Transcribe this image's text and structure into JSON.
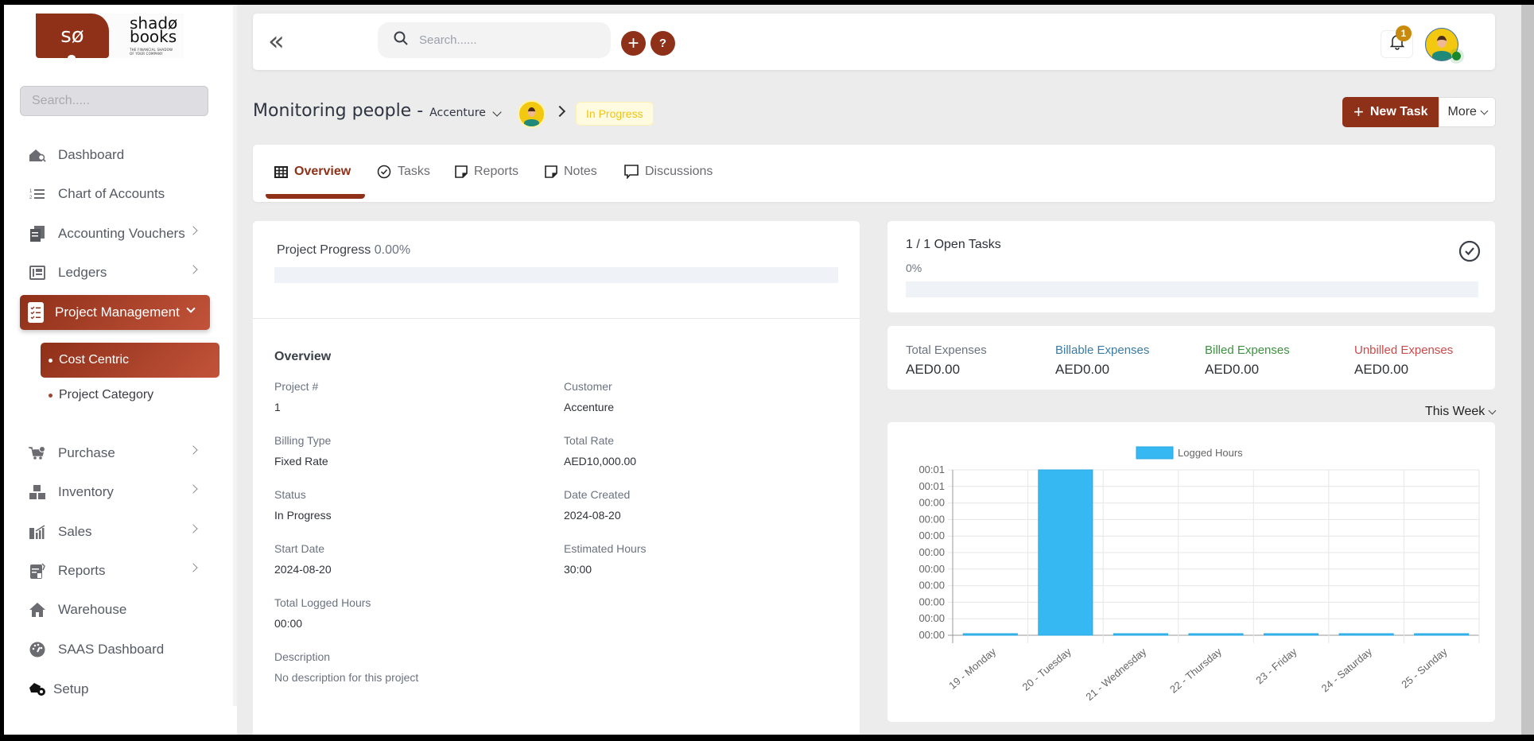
{
  "brand": {
    "logo_mark": "sø",
    "name_line1": "shadø",
    "name_line2": "books",
    "tagline_line1": "THE FINANCIAL SHADOW",
    "tagline_line2": "OF YOUR COMPANY",
    "accent_color": "#8f3019"
  },
  "sidebar": {
    "search_placeholder": "Search.....",
    "items": [
      {
        "label": "Dashboard",
        "icon": "dashboard-house-icon",
        "has_children": false
      },
      {
        "label": "Chart of Accounts",
        "icon": "numbered-list-icon",
        "has_children": false
      },
      {
        "label": "Accounting Vouchers",
        "icon": "vouchers-icon",
        "has_children": true
      },
      {
        "label": "Ledgers",
        "icon": "ledger-icon",
        "has_children": true
      },
      {
        "label": "Project Management",
        "icon": "checklist-icon",
        "has_children": true,
        "active": true,
        "expanded": true
      },
      {
        "label": "Purchase",
        "icon": "cart-icon",
        "has_children": true
      },
      {
        "label": "Inventory",
        "icon": "boxes-icon",
        "has_children": true
      },
      {
        "label": "Sales",
        "icon": "sales-chart-icon",
        "has_children": true
      },
      {
        "label": "Reports",
        "icon": "report-icon",
        "has_children": true
      },
      {
        "label": "Warehouse",
        "icon": "home-icon",
        "has_children": false
      },
      {
        "label": "SAAS Dashboard",
        "icon": "speedometer-icon",
        "has_children": false
      },
      {
        "label": "Setup",
        "icon": "setup-gear-icon",
        "has_children": false
      }
    ],
    "sub_items": [
      {
        "label": "Cost Centric",
        "active": true
      },
      {
        "label": "Project Category",
        "active": false
      }
    ]
  },
  "header": {
    "collapse_icon": "«",
    "search_placeholder": "Search......",
    "add_label": "+",
    "help_label": "?",
    "notification_count": "1"
  },
  "project": {
    "title": "Monitoring people",
    "separator": "-",
    "customer": "Accenture",
    "status": "In Progress",
    "new_task_label": "New Task",
    "new_task_icon": "+",
    "more_label": "More"
  },
  "tabs": [
    {
      "label": "Overview",
      "icon": "grid-icon",
      "active": true
    },
    {
      "label": "Tasks",
      "icon": "check-circle-icon",
      "active": false
    },
    {
      "label": "Reports",
      "icon": "note-icon",
      "active": false
    },
    {
      "label": "Notes",
      "icon": "note-icon",
      "active": false
    },
    {
      "label": "Discussions",
      "icon": "chat-icon",
      "active": false
    }
  ],
  "progress": {
    "label": "Project Progress",
    "value_text": "0.00%",
    "value": 0
  },
  "overview": {
    "title": "Overview",
    "fields": [
      {
        "label": "Project #",
        "value": "1"
      },
      {
        "label": "Customer",
        "value": "Accenture"
      },
      {
        "label": "Billing Type",
        "value": "Fixed Rate"
      },
      {
        "label": "Total Rate",
        "value": "AED10,000.00"
      },
      {
        "label": "Status",
        "value": "In Progress"
      },
      {
        "label": "Date Created",
        "value": "2024-08-20"
      },
      {
        "label": "Start Date",
        "value": "2024-08-20"
      },
      {
        "label": "Estimated Hours",
        "value": "30:00"
      },
      {
        "label": "Total Logged Hours",
        "value": "00:00"
      },
      {
        "label": "Description",
        "value": "No description for this project"
      }
    ]
  },
  "tasks_summary": {
    "title": "1 / 1 Open Tasks",
    "percent_text": "0%",
    "value": 0
  },
  "expenses": [
    {
      "label": "Total Expenses",
      "value": "AED0.00",
      "color": "#6b7280"
    },
    {
      "label": "Billable Expenses",
      "value": "AED0.00",
      "color": "#3a7ca5"
    },
    {
      "label": "Billed Expenses",
      "value": "AED0.00",
      "color": "#3f9142"
    },
    {
      "label": "Unbilled Expenses",
      "value": "AED0.00",
      "color": "#cc4a4a"
    }
  ],
  "chart_filter": "This Week",
  "chart_data": {
    "type": "bar",
    "title": "",
    "legend": [
      "Logged Hours"
    ],
    "legend_position": "top",
    "bar_color": "#36b9f2",
    "categories": [
      "19 - Monday",
      "20 - Tuesday",
      "21 - Wednesday",
      "22 - Thursday",
      "23 - Friday",
      "24 - Saturday",
      "25 - Sunday"
    ],
    "series": [
      {
        "name": "Logged Hours",
        "values": [
          0,
          1,
          0,
          0,
          0,
          0,
          0
        ]
      }
    ],
    "y_tick_labels": [
      "00:00",
      "00:00",
      "00:00",
      "00:00",
      "00:00",
      "00:00",
      "00:00",
      "00:00",
      "00:00",
      "00:01",
      "00:01"
    ],
    "ylim": [
      0,
      1
    ],
    "xlabel": "",
    "ylabel": "",
    "grid": true
  }
}
